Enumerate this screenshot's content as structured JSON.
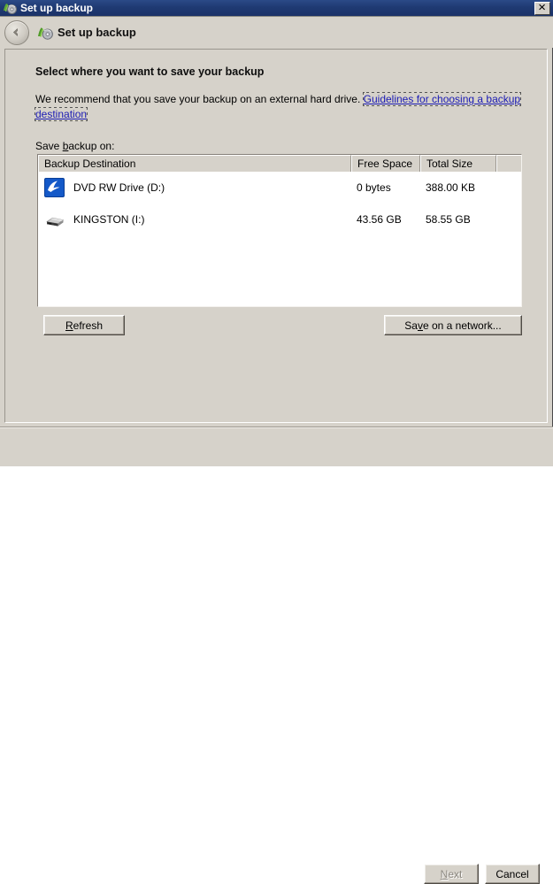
{
  "window": {
    "title": "Set up backup",
    "title_icon": "backup-icon",
    "close_label": "✕"
  },
  "nav": {
    "back_icon": "back-arrow-icon",
    "app_icon": "backup-icon",
    "title": "Set up backup"
  },
  "main": {
    "heading": "Select where you want to save your backup",
    "recommend_text": "We recommend that you save your backup on an external hard drive. ",
    "guidelines_link": "Guidelines for choosing a backup destination",
    "save_label_pre": "Save ",
    "save_label_accel": "b",
    "save_label_post": "ackup on:"
  },
  "list": {
    "columns": [
      {
        "key": "destination",
        "label": "Backup Destination"
      },
      {
        "key": "free",
        "label": "Free Space"
      },
      {
        "key": "total",
        "label": "Total Size"
      },
      {
        "key": "pad",
        "label": ""
      }
    ],
    "rows": [
      {
        "icon": "dvd-drive-icon",
        "destination": "DVD RW Drive (D:)",
        "free": "0 bytes",
        "total": "388.00 KB"
      },
      {
        "icon": "usb-flash-drive-icon",
        "destination": "KINGSTON (I:)",
        "free": "43.56 GB",
        "total": "58.55 GB"
      }
    ]
  },
  "buttons": {
    "refresh_pre": "",
    "refresh_accel": "R",
    "refresh_post": "efresh",
    "network_pre": "Sa",
    "network_accel": "v",
    "network_post": "e on a network...",
    "next_accel": "N",
    "next_post": "ext",
    "cancel": "Cancel"
  },
  "colors": {
    "window_background": "#d6d2ca",
    "titlebar_start": "#2b4a87",
    "titlebar_end": "#1b3268",
    "link": "#1a1ab4",
    "list_background": "#ffffff",
    "disabled_text": "#8c8880"
  }
}
